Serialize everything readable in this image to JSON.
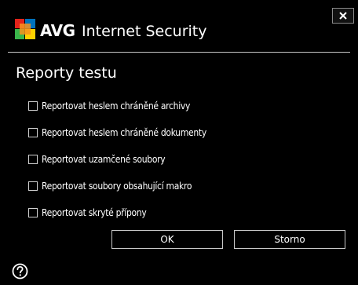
{
  "window": {
    "brand": "AVG",
    "product": "Internet Security",
    "close_icon": "close-icon",
    "help_icon": "help-icon"
  },
  "dialog": {
    "heading": "Reporty testu",
    "options": [
      {
        "label": "Reportovat heslem chráněné archivy",
        "checked": false
      },
      {
        "label": "Reportovat heslem chráněné dokumenty",
        "checked": false
      },
      {
        "label": "Reportovat uzamčené soubory",
        "checked": false
      },
      {
        "label": "Reportovat soubory obsahující makro",
        "checked": false
      },
      {
        "label": "Reportovat skryté přípony",
        "checked": false
      }
    ],
    "ok_label": "OK",
    "cancel_label": "Storno"
  },
  "colors": {
    "background": "#000000",
    "text": "#ffffff",
    "border": "#c8c8c8",
    "logo_red": "#e2231a",
    "logo_orange": "#f7941d",
    "logo_yellow": "#ffd200",
    "logo_green": "#39b54a",
    "logo_blue": "#0072bc"
  }
}
